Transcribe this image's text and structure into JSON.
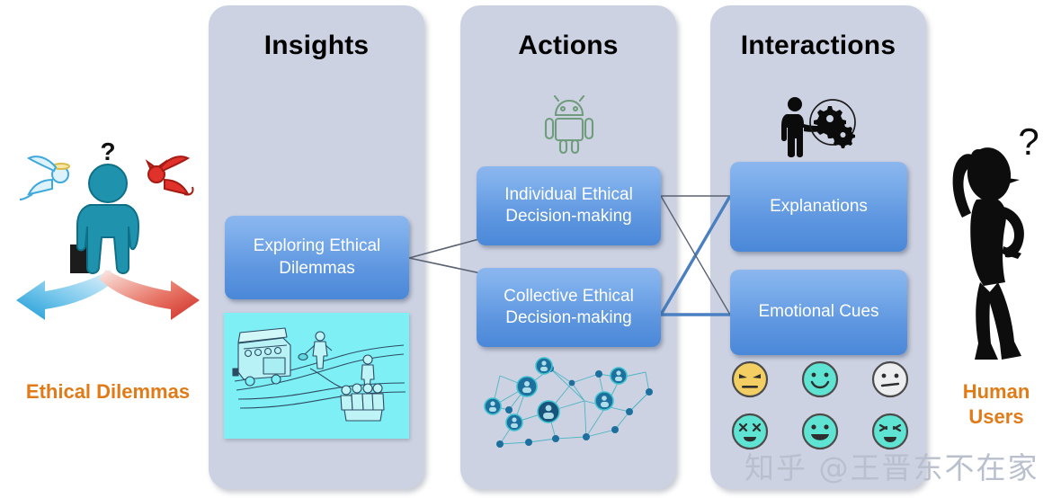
{
  "columns": [
    {
      "id": "insights",
      "title": "Insights"
    },
    {
      "id": "actions",
      "title": "Actions"
    },
    {
      "id": "interactions",
      "title": "Interactions"
    }
  ],
  "boxes": {
    "exploring": "Exploring Ethical Dilemmas",
    "individual": "Individual Ethical Decision-making",
    "collective": "Collective Ethical Decision-making",
    "explanations": "Explanations",
    "emotional": "Emotional Cues"
  },
  "side_labels": {
    "left": "Ethical Dilemmas",
    "right": "Human Users"
  },
  "icons": {
    "android": "android-robot-icon",
    "human_gears": "person-with-gears-icon",
    "left_actor": "person-angel-devil-dilemma-icon",
    "right_actor": "confused-person-question-mark-icon",
    "trolley": "trolley-problem-illustration",
    "network": "social-network-graph-illustration"
  },
  "emojis": [
    {
      "name": "angry-flat-face",
      "face": "#f3cf63",
      "mood": "annoyed"
    },
    {
      "name": "smiling-face",
      "face": "#5fe3d2",
      "mood": "smile"
    },
    {
      "name": "neutral-face",
      "face": "#eceef0",
      "mood": "neutral"
    },
    {
      "name": "dizzy-shocked-face",
      "face": "#5fe3d2",
      "mood": "shocked"
    },
    {
      "name": "happy-open-face",
      "face": "#5fe3d2",
      "mood": "happy"
    },
    {
      "name": "distressed-face",
      "face": "#5fe3d2",
      "mood": "distressed"
    }
  ],
  "colors": {
    "column_bg": "#ccd2e2",
    "box_top": "#8cb6ee",
    "box_bottom": "#4a88d8",
    "label_orange": "#e07b18",
    "trolley_bg": "#7ef0f5",
    "android_green": "#6f9c7c",
    "connector_blue": "#4a7fc1",
    "connector_thin": "#5a6272",
    "watermark": "#b9bfcd"
  },
  "watermark": "知乎 @王晋东不在家"
}
